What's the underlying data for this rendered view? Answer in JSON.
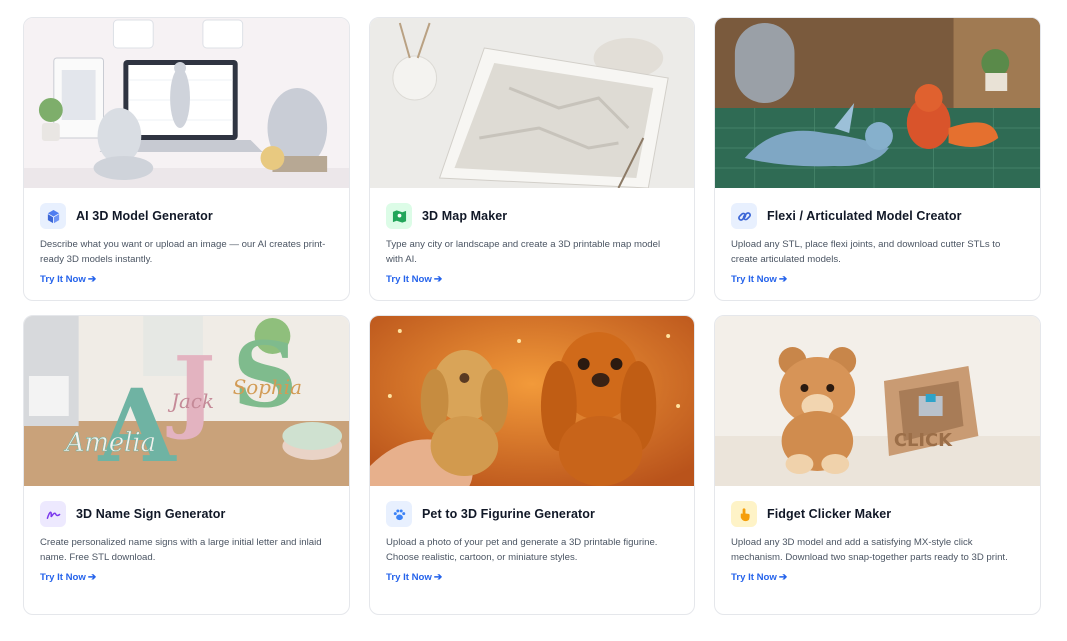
{
  "colors": {
    "link": "#2563eb",
    "card_border": "#e5e7eb",
    "icon_blue_bg": "#e8f0fe",
    "icon_green_bg": "#dcfce7",
    "icon_purple_bg": "#ede9fe",
    "icon_orange_bg": "#fef3c7"
  },
  "cards": [
    {
      "title": "AI 3D Model Generator",
      "icon": "cube-icon",
      "description": "Describe what you want or upload an image — our AI creates print-ready 3D models instantly.",
      "cta": "Try It Now"
    },
    {
      "title": "3D Map Maker",
      "icon": "map-icon",
      "description": "Type any city or landscape and create a 3D printable map model with AI.",
      "cta": "Try It Now"
    },
    {
      "title": "Flexi / Articulated Model Creator",
      "icon": "link-icon",
      "description": "Upload any STL, place flexi joints, and download cutter STLs to create articulated models.",
      "cta": "Try It Now"
    },
    {
      "title": "3D Name Sign Generator",
      "icon": "signature-icon",
      "description": "Create personalized name signs with a large initial letter and inlaid name. Free STL download.",
      "cta": "Try It Now"
    },
    {
      "title": "Pet to 3D Figurine Generator",
      "icon": "paw-icon",
      "description": "Upload a photo of your pet and generate a 3D printable figurine. Choose realistic, cartoon, or miniature styles.",
      "cta": "Try It Now"
    },
    {
      "title": "Fidget Clicker Maker",
      "icon": "pointer-icon",
      "description": "Upload any 3D model and add a satisfying MX-style click mechanism. Download two snap-together parts ready to 3D print.",
      "cta": "Try It Now"
    }
  ],
  "images": {
    "sign_letters": [
      "A",
      "J",
      "S"
    ],
    "sign_names": [
      "Jack",
      "Sophia",
      "Amelia"
    ],
    "clicker_text": "CLICK"
  }
}
